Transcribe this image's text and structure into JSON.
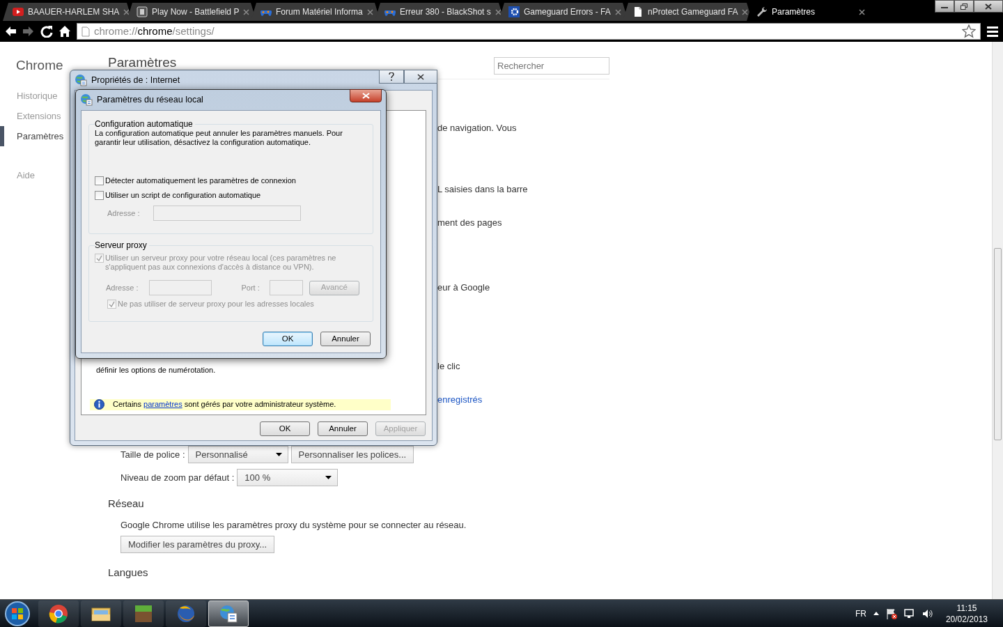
{
  "browser": {
    "tabs": [
      {
        "title": "BAAUER-HARLEM SHA",
        "kind": "video",
        "selected": false
      },
      {
        "title": "Play Now - Battlefield P",
        "kind": "square",
        "selected": false
      },
      {
        "title": "Forum Matériel Informa",
        "kind": "gamepad",
        "selected": false
      },
      {
        "title": "Erreur 380 - BlackShot s",
        "kind": "gamepad",
        "selected": false
      },
      {
        "title": "Gameguard Errors - FA",
        "kind": "gear",
        "selected": false
      },
      {
        "title": "nProtect Gameguard FA",
        "kind": "page",
        "selected": false
      },
      {
        "title": "Paramètres",
        "kind": "wrench",
        "selected": true
      }
    ],
    "address": {
      "scheme": "chrome://",
      "host": "chrome",
      "path": "/settings/"
    }
  },
  "settings": {
    "brand": "Chrome",
    "nav": [
      {
        "label": "Historique",
        "selected": false
      },
      {
        "label": "Extensions",
        "selected": false
      },
      {
        "label": "Paramètres",
        "selected": true
      },
      {
        "label": "Aide",
        "selected": false
      }
    ],
    "title": "Paramètres",
    "search": {
      "placeholder": "Rechercher"
    },
    "fragments": [
      {
        "text": "de navigation. Vous",
        "kind": "text"
      },
      {
        "text": "L saisies dans la barre",
        "kind": "text"
      },
      {
        "text": "ment des pages",
        "kind": "text"
      },
      {
        "text": "eur à Google",
        "kind": "text"
      },
      {
        "text": "le clic",
        "kind": "text"
      },
      {
        "text": "enregistrés",
        "kind": "link"
      }
    ],
    "font_size": {
      "label": "Taille de police :",
      "value": "Personnalisé",
      "button": "Personnaliser les polices..."
    },
    "zoom": {
      "label": "Niveau de zoom par défaut :",
      "value": "100 %"
    },
    "network": {
      "heading": "Réseau",
      "text": "Google Chrome utilise les paramètres proxy du système pour se connecter au réseau.",
      "button": "Modifier les paramètres du proxy..."
    },
    "languages": {
      "heading": "Langues"
    }
  },
  "internet_properties": {
    "title": "Propriétés de : Internet",
    "body_text": "définir les options de numérotation.",
    "notice": {
      "before": "Certains",
      "link": "paramètres",
      "after": "sont gérés par votre administrateur système."
    },
    "buttons": [
      {
        "label": "OK",
        "disabled": false
      },
      {
        "label": "Annuler",
        "disabled": false
      },
      {
        "label": "Appliquer",
        "disabled": true
      }
    ]
  },
  "lan_settings": {
    "title": "Paramètres du réseau local",
    "auto_config": {
      "legend": "Configuration automatique",
      "description": "La configuration automatique peut annuler les paramètres manuels. Pour garantir leur utilisation, désactivez la configuration automatique.",
      "options": [
        {
          "label": "Détecter automatiquement les paramètres de connexion",
          "checked": false,
          "disabled": false
        },
        {
          "label": "Utiliser un script de configuration automatique",
          "checked": false,
          "disabled": false
        }
      ],
      "address": {
        "label": "Adresse :",
        "disabled": true
      }
    },
    "proxy": {
      "legend": "Serveur proxy",
      "use_proxy": {
        "label": "Utiliser un serveur proxy pour votre réseau local (ces paramètres ne s'appliquent pas aux connexions d'accès à distance ou VPN).",
        "checked": true,
        "disabled": true
      },
      "address_label": "Adresse :",
      "port_label": "Port :",
      "advanced_button": "Avancé",
      "bypass_local": {
        "label": "Ne pas utiliser de serveur proxy pour les adresses locales",
        "checked": true,
        "disabled": true
      }
    },
    "buttons": [
      {
        "label": "OK",
        "default": true
      },
      {
        "label": "Annuler",
        "default": false
      }
    ]
  },
  "taskbar": {
    "apps": [
      {
        "kind": "chrome",
        "active": false
      },
      {
        "kind": "folder",
        "active": false
      },
      {
        "kind": "block",
        "active": false
      },
      {
        "kind": "firefox",
        "active": false
      },
      {
        "kind": "options",
        "active": true
      }
    ],
    "language": "FR",
    "time": "11:15",
    "date": "20/02/2013"
  }
}
